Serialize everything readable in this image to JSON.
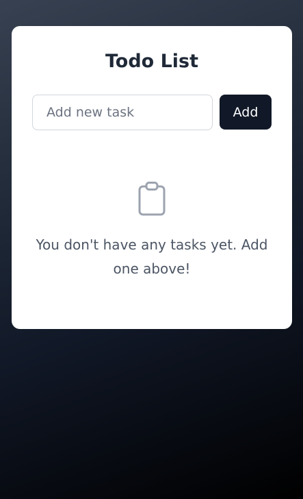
{
  "app": {
    "title": "Todo List"
  },
  "new_task": {
    "placeholder": "Add new task",
    "value": ""
  },
  "add_button": {
    "label": "Add"
  },
  "empty_state": {
    "icon": "clipboard-icon",
    "message": "You don't have any tasks yet. Add one above!"
  },
  "colors": {
    "card_bg": "#ffffff",
    "title": "#1f2937",
    "button_bg": "#111827",
    "button_text": "#ffffff",
    "muted_text": "#4b5563",
    "icon_stroke": "#9ca3af",
    "input_border": "#d1d5db"
  }
}
